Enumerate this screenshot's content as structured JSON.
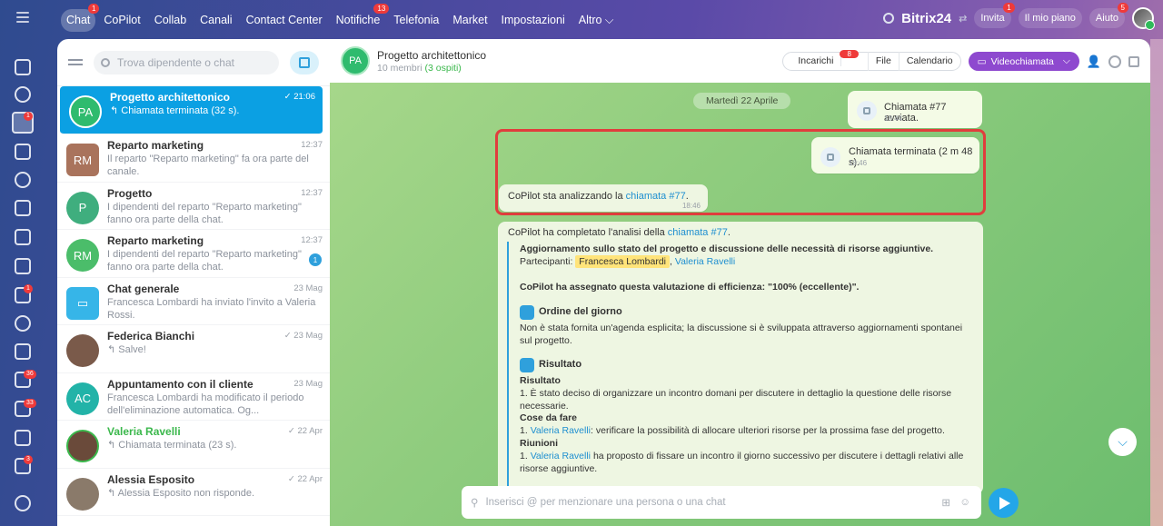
{
  "topnav": {
    "items": [
      {
        "label": "Chat",
        "badge": "1"
      },
      {
        "label": "CoPilot"
      },
      {
        "label": "Collab"
      },
      {
        "label": "Canali"
      },
      {
        "label": "Contact Center"
      },
      {
        "label": "Notifiche",
        "badge": "13"
      },
      {
        "label": "Telefonia"
      },
      {
        "label": "Market"
      },
      {
        "label": "Impostazioni"
      },
      {
        "label": "Altro ⌵"
      }
    ],
    "logo": "Bitrix24",
    "invite": "Invita",
    "invite_badge": "1",
    "my_plan": "Il mio piano",
    "help": "Aiuto",
    "help_badge": "5"
  },
  "leftbar_badges": [
    "1",
    "1",
    "36",
    "33",
    "3"
  ],
  "chatlist": {
    "search_placeholder": "Trova dipendente o chat",
    "items": [
      {
        "avatar": "PA",
        "name": "Progetto architettonico",
        "snippet": "↰ Chiamata terminata (32 s).",
        "time": "✓ 21:06",
        "color": "#2fbb6e"
      },
      {
        "avatar": "RM",
        "name": "Reparto marketing",
        "snippet": "Il reparto \"Reparto marketing\" fa ora parte del canale.",
        "time": "12:37",
        "color": "#a9735c"
      },
      {
        "avatar": "P",
        "name": "Progetto",
        "snippet": "I dipendenti del reparto \"Reparto marketing\" fanno ora parte della chat.",
        "time": "12:37",
        "color": "#3fae7e"
      },
      {
        "avatar": "RM",
        "name": "Reparto marketing",
        "snippet": "I dipendenti del reparto \"Reparto marketing\" fanno ora parte della chat.",
        "time": "12:37",
        "color": "#4bbd6a",
        "count": "1"
      },
      {
        "avatar": "",
        "name": "Chat generale",
        "snippet": "Francesca Lombardi ha inviato l'invito a Valeria Rossi.",
        "time": "23 Mag",
        "color": "#36b5e8"
      },
      {
        "avatar": "",
        "name": "Federica Bianchi",
        "snippet": "↰ Salve!",
        "time": "✓ 23 Mag",
        "color": "#7a5a4a"
      },
      {
        "avatar": "AC",
        "name": "Appuntamento con il cliente",
        "snippet": "Francesca Lombardi ha modificato il periodo dell'eliminazione automatica. Og...",
        "time": "23 Mag",
        "color": "#22b3a8"
      },
      {
        "avatar": "",
        "name": "Valeria Ravelli",
        "snippet": "↰ Chiamata terminata (23 s).",
        "time": "✓ 22 Apr",
        "color": "#6a4a3a"
      },
      {
        "avatar": "",
        "name": "Alessia Esposito",
        "snippet": "↰ Alessia Esposito non risponde.",
        "time": "✓ 22 Apr",
        "color": "#8a7a6a"
      }
    ]
  },
  "chat": {
    "avatar": "PA",
    "title": "Progetto architettonico",
    "members": "10 membri",
    "guests": "(3 ospiti)",
    "tasks": "Incarichi",
    "tasks_badge": "8",
    "file": "File",
    "calendar": "Calendario",
    "video": "Videochiamata",
    "date": "Martedì 22 Aprile",
    "msg1": {
      "text": "Chiamata #77 avviata.",
      "time": "18:44"
    },
    "msg2": {
      "text": "Chiamata terminata (2 m 48 s).",
      "time": "18:46"
    },
    "msg3": {
      "text_pre": "CoPilot sta analizzando la ",
      "link": "chiamata #77",
      "text_post": ".",
      "time": "18:46"
    },
    "analysis": {
      "lead_pre": "CoPilot ha completato l'analisi della ",
      "lead_link": "chiamata #77",
      "lead_post": ".",
      "headline": "Aggiornamento sullo stato del progetto e discussione delle necessità di risorse aggiuntive.",
      "participants_label": "Partecipanti:",
      "participant1": "Francesca Lombardi",
      "participant2": "Valeria Ravelli",
      "efficiency": "CoPilot ha assegnato questa valutazione di efficienza: \"100% (eccellente)\".",
      "agenda_title": "Ordine del giorno",
      "agenda_text": "Non è stata fornita un'agenda esplicita; la discussione si è sviluppata attraverso aggiornamenti spontanei sul progetto.",
      "results_title": "Risultato",
      "result_sub": "Risultato",
      "result_1": "1. È stato deciso di organizzare un incontro domani per discutere in dettaglio la questione delle risorse necessarie.",
      "todo_sub": "Cose da fare",
      "todo_1_link": "Valeria Ravelli",
      "todo_1_text": ": verificare la possibilità di allocare ulteriori risorse per la prossima fase del progetto.",
      "meetings_sub": "Riunioni",
      "meet_1_link": "Valeria Ravelli",
      "meet_1_text": " ha proposto di fissare un incontro il giorno successivo per discutere i dettagli relativi alle risorse aggiuntive."
    },
    "input_placeholder": "Inserisci @ per menzionare una persona o una chat"
  }
}
